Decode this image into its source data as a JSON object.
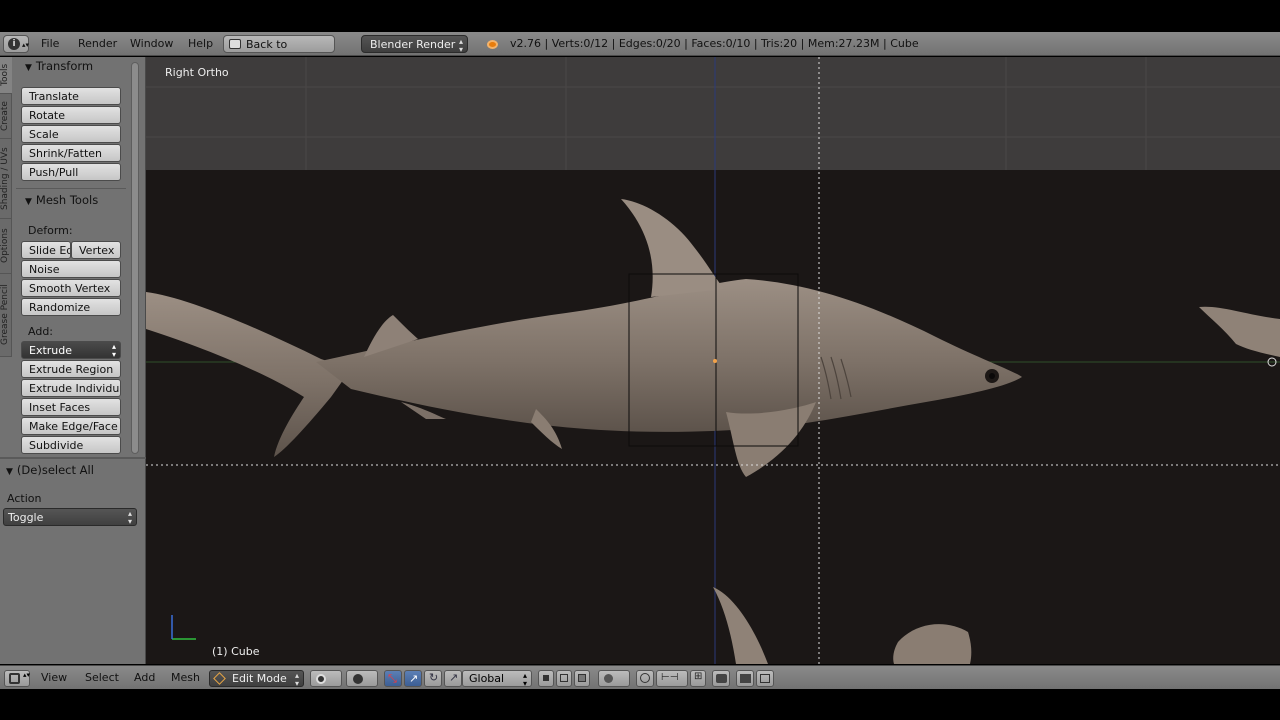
{
  "info_header": {
    "menu": [
      "File",
      "Render",
      "Window",
      "Help"
    ],
    "back_button": "Back to Previous",
    "render_engine": "Blender Render",
    "stats": "v2.76 | Verts:0/12 | Edges:0/20 | Faces:0/10 | Tris:20 | Mem:27.23M | Cube"
  },
  "tool_tabs": [
    "Tools",
    "Create",
    "Shading / UVs",
    "Options",
    "Grease Pencil"
  ],
  "transform_panel": {
    "title": "Transform",
    "buttons": [
      "Translate",
      "Rotate",
      "Scale",
      "Shrink/Fatten",
      "Push/Pull"
    ]
  },
  "mesh_tools_panel": {
    "title": "Mesh Tools",
    "deform_label": "Deform:",
    "deform_pair": [
      "Slide Ed",
      "Vertex"
    ],
    "deform_buttons": [
      "Noise",
      "Smooth Vertex",
      "Randomize"
    ],
    "add_label": "Add:",
    "extrude": "Extrude",
    "add_buttons": [
      "Extrude Region",
      "Extrude Individual",
      "Inset Faces",
      "Make Edge/Face",
      "Subdivide"
    ]
  },
  "operator_panel": {
    "title": "(De)select All",
    "action_label": "Action",
    "action_value": "Toggle"
  },
  "viewport": {
    "view_name": "Right Ortho",
    "object_label": "(1) Cube"
  },
  "footer": {
    "menu": [
      "View",
      "Select",
      "Add",
      "Mesh"
    ],
    "mode": "Edit Mode",
    "orientation": "Global"
  },
  "colors": {
    "header_bg": "#7f7f7f",
    "panel_bg": "#727272",
    "viewport_bg": "#1b1716",
    "viewport_upper": "#3e3c3c",
    "shark": "#8f8175",
    "active_blue": "#4a6ea9"
  }
}
